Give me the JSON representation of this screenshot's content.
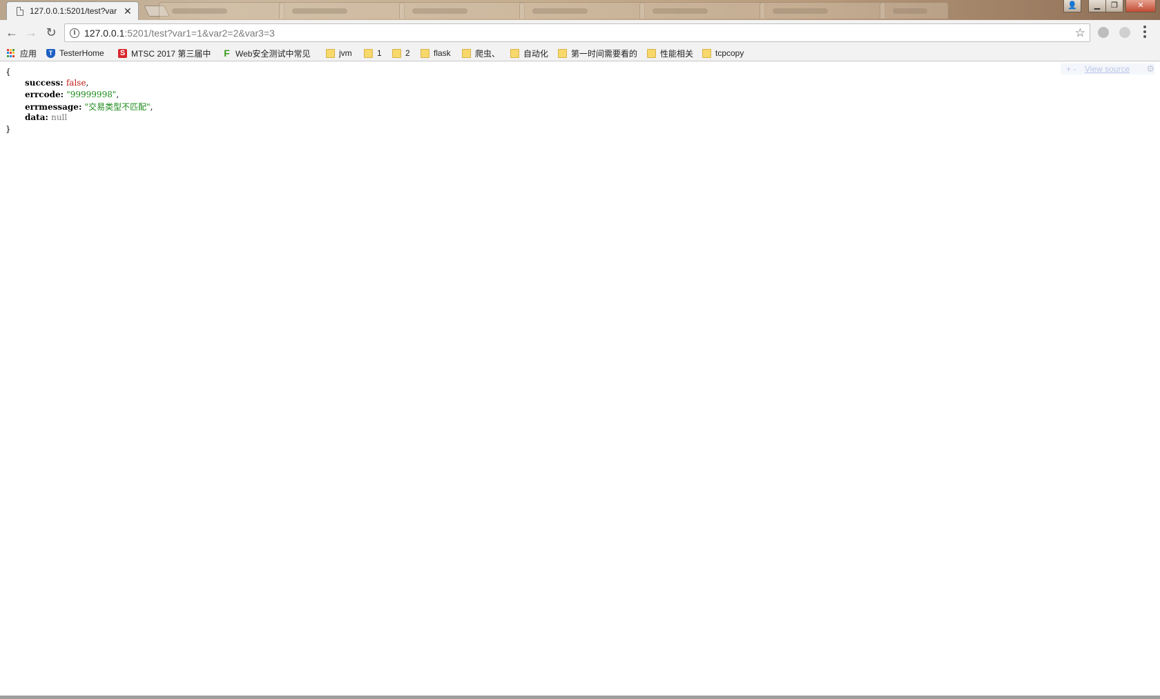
{
  "browser": {
    "active_tab": {
      "title": "127.0.0.1:5201/test?var",
      "close_glyph": "✕"
    },
    "address_bar": {
      "host": "127.0.0.1",
      "rest": ":5201/test?var1=1&var2=2&var3=3"
    },
    "icons": {
      "back": "←",
      "forward": "→",
      "reload": "↻",
      "star": "☆",
      "info": "i"
    },
    "window_controls": {
      "user": "👤",
      "minimize": "▁",
      "restore": "❐",
      "close": "✕"
    }
  },
  "bookmarks": [
    {
      "label": "应用",
      "icon": "apps-icon"
    },
    {
      "label": "TesterHome",
      "icon": "shield-icon",
      "glyph": "T"
    },
    {
      "label": "MTSC 2017 第三届中",
      "icon": "s-icon",
      "glyph": "S"
    },
    {
      "label": "Web安全测试中常见",
      "icon": "f-icon",
      "glyph": "F"
    },
    {
      "label": "jvm",
      "icon": "folder-icon"
    },
    {
      "label": "1",
      "icon": "folder-icon"
    },
    {
      "label": "2",
      "icon": "folder-icon"
    },
    {
      "label": "flask",
      "icon": "folder-icon"
    },
    {
      "label": "爬虫、",
      "icon": "folder-icon"
    },
    {
      "label": "自动化",
      "icon": "folder-icon"
    },
    {
      "label": "第一时间需要看的",
      "icon": "folder-icon"
    },
    {
      "label": "性能相关",
      "icon": "folder-icon"
    },
    {
      "label": "tcpcopy",
      "icon": "folder-icon"
    }
  ],
  "json_view": {
    "open_brace": "{",
    "close_brace": "}",
    "entries": [
      {
        "key": "success",
        "value": "false",
        "type": "bool",
        "trail": ","
      },
      {
        "key": "errcode",
        "value": "\"99999998\"",
        "type": "string",
        "trail": ","
      },
      {
        "key": "errmessage",
        "value": "\"交易类型不匹配\"",
        "type": "string",
        "trail": ","
      },
      {
        "key": "data",
        "value": "null",
        "type": "null",
        "trail": ""
      }
    ],
    "toolbar": {
      "plus_minus": "+ -",
      "view_source": "View source",
      "gear": "⚙"
    }
  }
}
